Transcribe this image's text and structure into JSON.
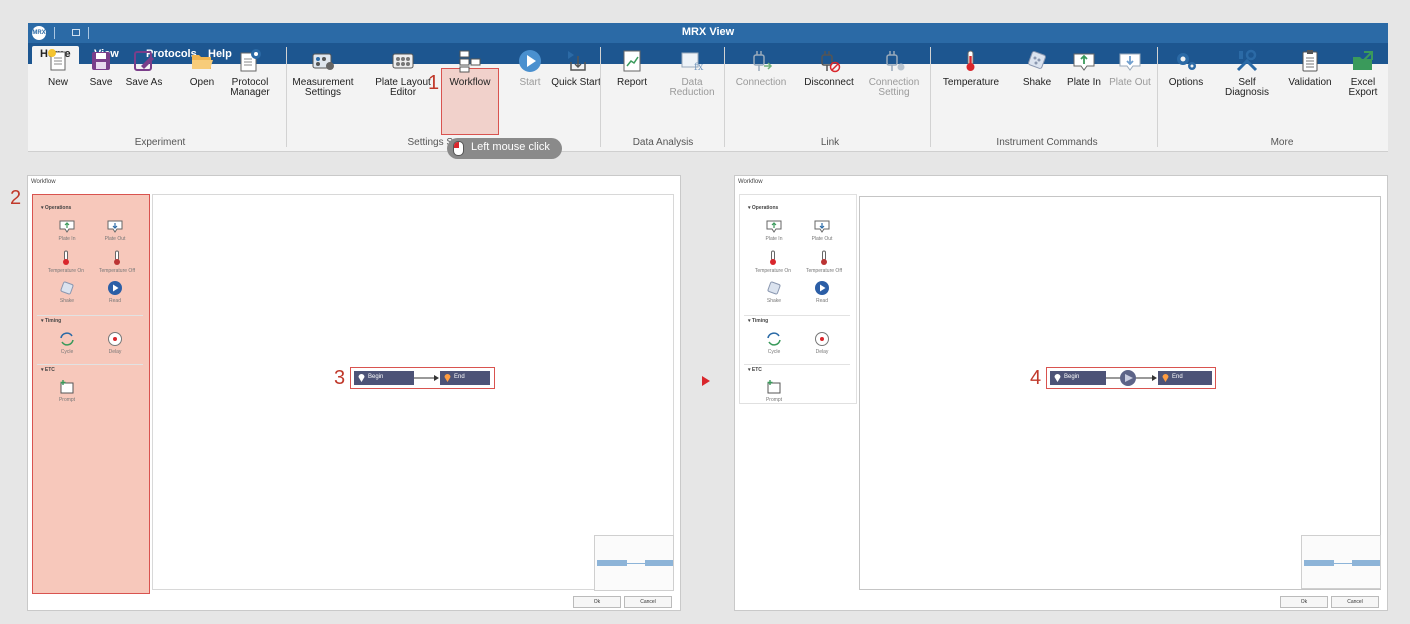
{
  "window": {
    "title": "MRX View",
    "logo": "mrx"
  },
  "tabs": [
    {
      "label": "Home",
      "active": true
    },
    {
      "label": "View"
    },
    {
      "label": "Protocols"
    },
    {
      "label": "Help"
    }
  ],
  "ribbon": {
    "buttons": [
      {
        "label": "New",
        "icon": "new-document-icon"
      },
      {
        "label": "Save",
        "icon": "save-icon"
      },
      {
        "label": "Save As",
        "icon": "save-as-icon"
      },
      {
        "label": "Open",
        "icon": "folder-open-icon"
      },
      {
        "label": "Protocol Manager",
        "icon": "protocol-manager-icon"
      },
      {
        "label": "Measurement Settings",
        "icon": "measurement-settings-icon"
      },
      {
        "label": "Plate Layout Editor",
        "icon": "plate-layout-icon"
      },
      {
        "label": "Workflow",
        "icon": "workflow-icon"
      },
      {
        "label": "Start",
        "icon": "play-icon",
        "disabled": true
      },
      {
        "label": "Quick Start",
        "icon": "quick-start-icon"
      },
      {
        "label": "Report",
        "icon": "report-icon"
      },
      {
        "label": "Data Reduction",
        "icon": "data-reduction-icon",
        "disabled": true
      },
      {
        "label": "Connection",
        "icon": "plug-connect-icon",
        "disabled": true
      },
      {
        "label": "Disconnect",
        "icon": "plug-disconnect-icon"
      },
      {
        "label": "Connection Setting",
        "icon": "plug-settings-icon",
        "disabled": true
      },
      {
        "label": "Temperature",
        "icon": "thermometer-icon"
      },
      {
        "label": "Shake",
        "icon": "shake-icon"
      },
      {
        "label": "Plate In",
        "icon": "plate-in-icon"
      },
      {
        "label": "Plate Out",
        "icon": "plate-out-icon",
        "disabled": true
      },
      {
        "label": "Options",
        "icon": "gears-icon"
      },
      {
        "label": "Self Diagnosis",
        "icon": "tools-icon"
      },
      {
        "label": "Validation",
        "icon": "clipboard-icon"
      },
      {
        "label": "Excel Export",
        "icon": "excel-export-icon"
      }
    ],
    "groups": [
      "Experiment",
      "Settings Setup",
      "Data Analysis",
      "Link",
      "Instrument Commands",
      "More"
    ]
  },
  "tooltip": "Left mouse click",
  "steps": [
    "1",
    "2",
    "3",
    "4"
  ],
  "dialog": {
    "title": "Workflow",
    "categories": {
      "operations": "Operations",
      "timing": "Timing",
      "etc": "ETC"
    },
    "items": {
      "plate_in": "Plate In",
      "plate_out": "Plate Out",
      "temp_on": "Temperature On",
      "temp_off": "Temperature Off",
      "shake": "Shake",
      "read": "Read",
      "cycle": "Cycle",
      "delay": "Delay",
      "prompt": "Prompt"
    },
    "nodes": {
      "begin": "Begin",
      "end": "End"
    },
    "ok": "Ok",
    "cancel": "Cancel"
  },
  "colors": {
    "titlebar": "#2b6aa6",
    "tabbar": "#1d5690",
    "node": "#4d5377",
    "highlight": "#d9534f"
  }
}
